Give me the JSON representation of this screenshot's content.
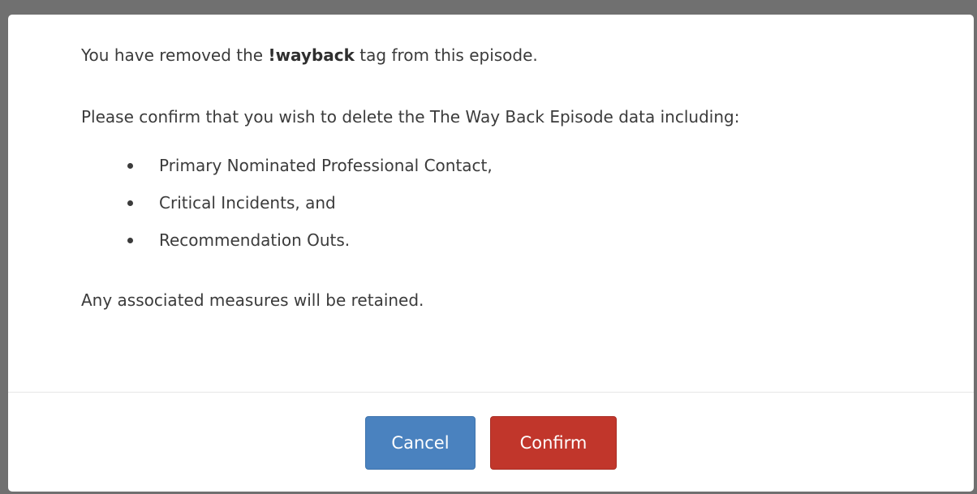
{
  "dialog": {
    "intro_prefix": "You have removed the ",
    "tag_name": "!wayback",
    "intro_suffix": " tag from this episode.",
    "confirm_prompt": "Please confirm that you wish to delete the The Way Back Episode data including:",
    "items": [
      "Primary Nominated Professional Contact,",
      "Critical Incidents, and",
      "Recommendation Outs."
    ],
    "retention_note": "Any associated measures will be retained."
  },
  "footer": {
    "cancel_label": "Cancel",
    "confirm_label": "Confirm"
  },
  "colors": {
    "cancel": "#4a82bf",
    "confirm": "#c1362b"
  }
}
